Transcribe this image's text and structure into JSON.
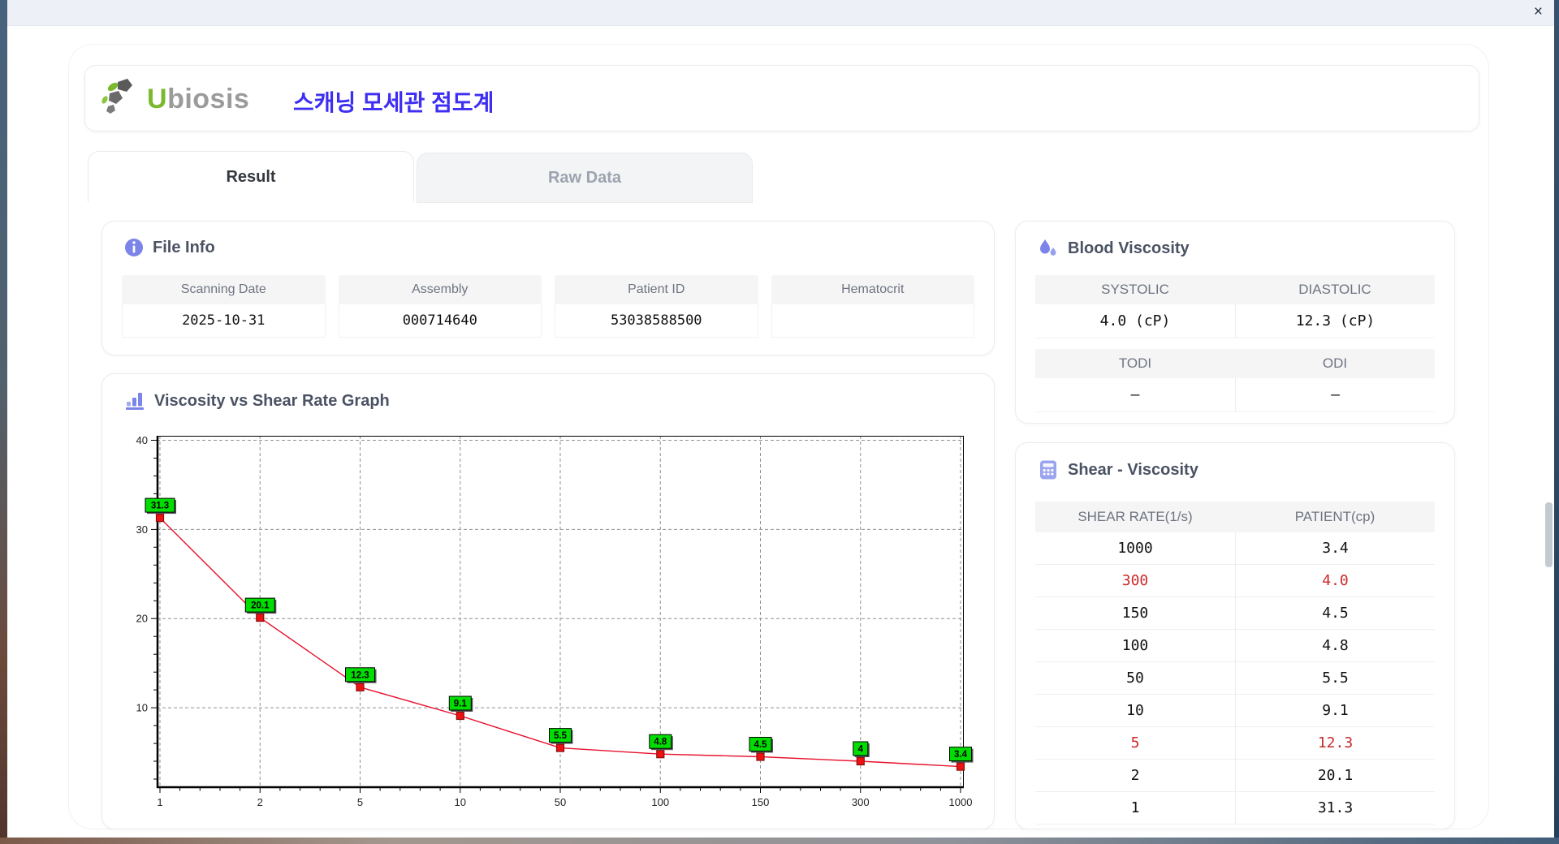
{
  "window": {
    "close_label": "×"
  },
  "header": {
    "logo_u": "U",
    "logo_rest": "biosis",
    "app_title": "스캐닝 모세관 점도계"
  },
  "tabs": [
    {
      "label": "Result",
      "active": true
    },
    {
      "label": "Raw Data",
      "active": false
    }
  ],
  "file_info": {
    "title": "File Info",
    "fields": [
      {
        "label": "Scanning Date",
        "value": "2025-10-31"
      },
      {
        "label": "Assembly",
        "value": "000714640"
      },
      {
        "label": "Patient ID",
        "value": "53038588500"
      },
      {
        "label": "Hematocrit",
        "value": ""
      }
    ]
  },
  "blood_viscosity": {
    "title": "Blood Viscosity",
    "groups": [
      {
        "cols": [
          {
            "label": "SYSTOLIC",
            "value": "4.0 (cP)"
          },
          {
            "label": "DIASTOLIC",
            "value": "12.3 (cP)"
          }
        ]
      },
      {
        "cols": [
          {
            "label": "TODI",
            "value": "–"
          },
          {
            "label": "ODI",
            "value": "–"
          }
        ]
      }
    ]
  },
  "graph": {
    "title": "Viscosity vs Shear Rate Graph"
  },
  "shear_table": {
    "title": "Shear - Viscosity",
    "headers": [
      "SHEAR RATE(1/s)",
      "PATIENT(cp)"
    ],
    "rows": [
      {
        "shear": "1000",
        "patient": "3.4",
        "highlight": false
      },
      {
        "shear": "300",
        "patient": "4.0",
        "highlight": true
      },
      {
        "shear": "150",
        "patient": "4.5",
        "highlight": false
      },
      {
        "shear": "100",
        "patient": "4.8",
        "highlight": false
      },
      {
        "shear": "50",
        "patient": "5.5",
        "highlight": false
      },
      {
        "shear": "10",
        "patient": "9.1",
        "highlight": false
      },
      {
        "shear": "5",
        "patient": "12.3",
        "highlight": true
      },
      {
        "shear": "2",
        "patient": "20.1",
        "highlight": false
      },
      {
        "shear": "1",
        "patient": "31.3",
        "highlight": false
      }
    ]
  },
  "colors": {
    "accent": "#7b84e8",
    "accent_light": "#9aa3ee",
    "highlight_red": "#c92a2a",
    "title_blue": "#3d2ef2",
    "logo_green": "#7ab82e",
    "chart_line": "#e8112d",
    "chart_marker": "#ee1111",
    "chart_marker_border": "#8a0f0f",
    "chart_label_bg": "#00dd00",
    "grid_gray": "#909090"
  },
  "chart_data": {
    "type": "line",
    "x_scale": "category",
    "categories": [
      "1",
      "2",
      "5",
      "10",
      "50",
      "100",
      "150",
      "300",
      "1000"
    ],
    "series": [
      {
        "name": "PATIENT",
        "values": [
          31.3,
          20.1,
          12.3,
          9.1,
          5.5,
          4.8,
          4.5,
          4.0,
          3.4
        ],
        "point_labels": [
          "31.3",
          "20.1",
          "12.3",
          "9.1",
          "5.5",
          "4.8",
          "4.5",
          "4",
          "3.4"
        ]
      }
    ],
    "title": "Viscosity vs Shear Rate Graph",
    "xlabel": "",
    "ylabel": "",
    "ylim": [
      1,
      40.5
    ],
    "yticks": [
      10,
      20,
      30,
      40
    ],
    "grid": true,
    "legend": false
  }
}
